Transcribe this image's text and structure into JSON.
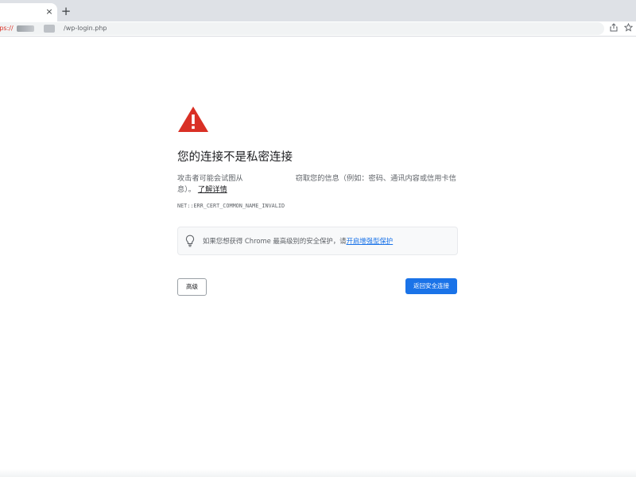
{
  "browser": {
    "tab_close": "×",
    "new_tab": "+",
    "url_scheme": "https://",
    "url_path": "/wp-login.php",
    "share_icon": "share-icon",
    "bookmark_icon": "star-icon"
  },
  "interstitial": {
    "heading": "您的连接不是私密连接",
    "body_prefix": "攻击者可能会试图从",
    "body_suffix": "窃取您的信息（例如：密码、通讯内容或信用卡信息）。",
    "learn_more": "了解详情",
    "error_code": "NET::ERR_CERT_COMMON_NAME_INVALID",
    "enhanced_prefix": "如果您想获得 Chrome 最高级别的安全保护，请",
    "enhanced_link": "开启增强型保护",
    "advanced_button": "高级",
    "back_button": "返回安全连接"
  },
  "colors": {
    "warning_red": "#d93025",
    "primary_blue": "#1a73e8",
    "tab_strip": "#dee1e6"
  }
}
